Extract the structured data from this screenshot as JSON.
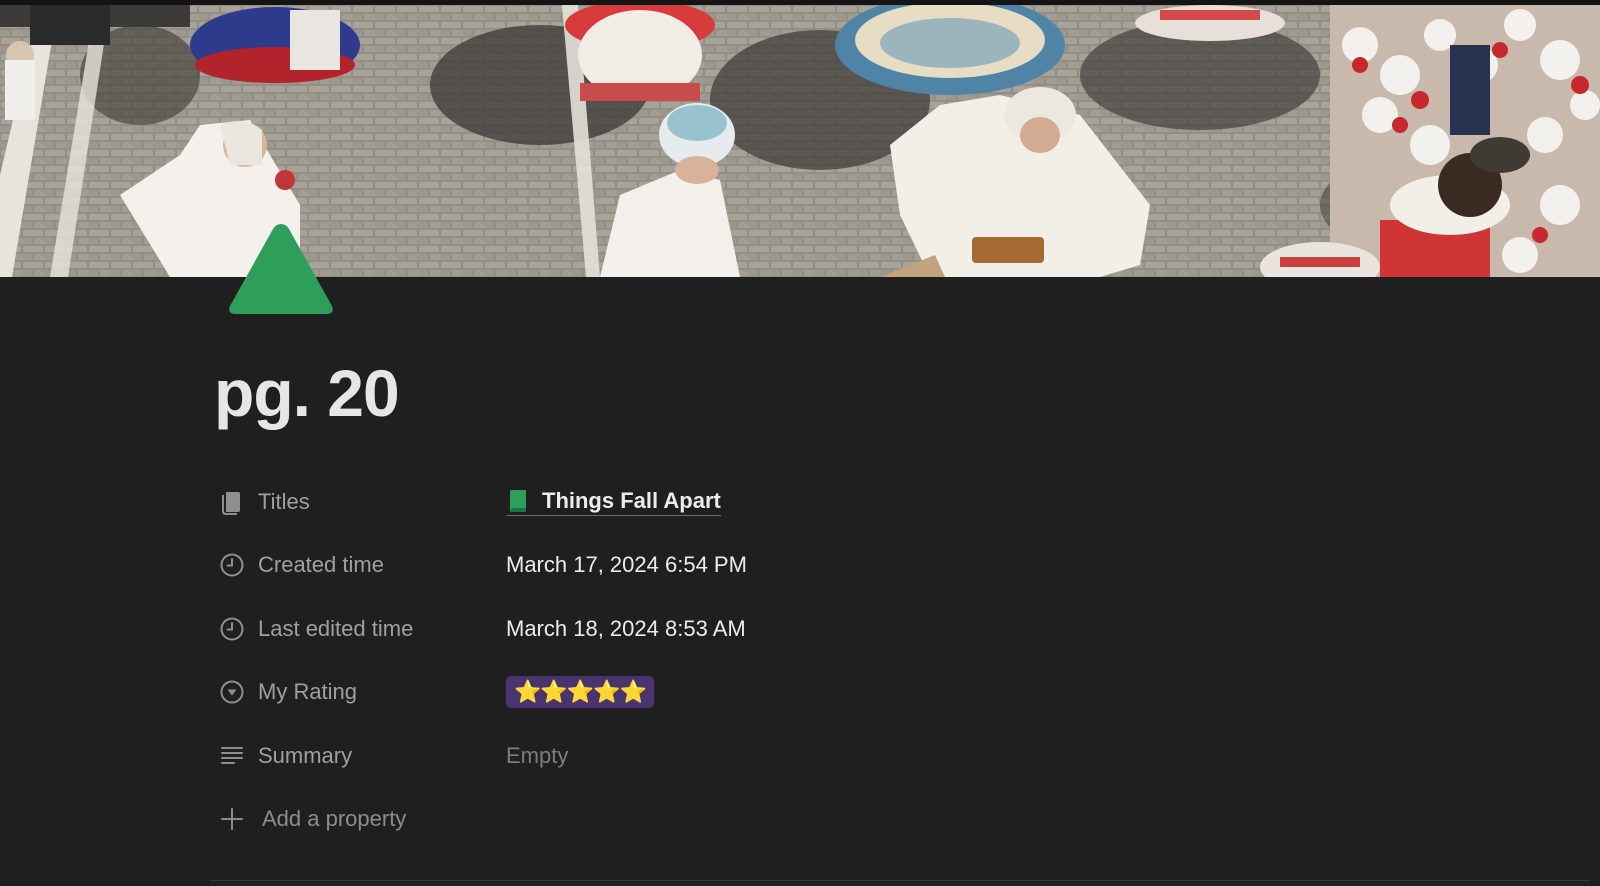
{
  "page": {
    "title": "pg. 20",
    "icon": "green-triangle-icon"
  },
  "cover": {
    "icon": "cover-image"
  },
  "properties": [
    {
      "icon": "relation-icon",
      "label": "Titles",
      "value": "Things Fall Apart",
      "value_icon": "green-book-icon"
    },
    {
      "icon": "clock-icon",
      "label": "Created time",
      "value": "March 17, 2024 6:54 PM"
    },
    {
      "icon": "clock-icon",
      "label": "Last edited time",
      "value": "March 18, 2024 8:53 AM"
    },
    {
      "icon": "select-icon",
      "label": "My Rating",
      "value": "⭐⭐⭐⭐⭐"
    },
    {
      "icon": "text-lines-icon",
      "label": "Summary",
      "value": "Empty"
    }
  ],
  "add_property": {
    "icon": "plus-icon",
    "label": "Add a property"
  },
  "colors": {
    "background": "#1f1f1f",
    "accent_green": "#2e9e5b",
    "rating_badge": "#4a3470"
  }
}
